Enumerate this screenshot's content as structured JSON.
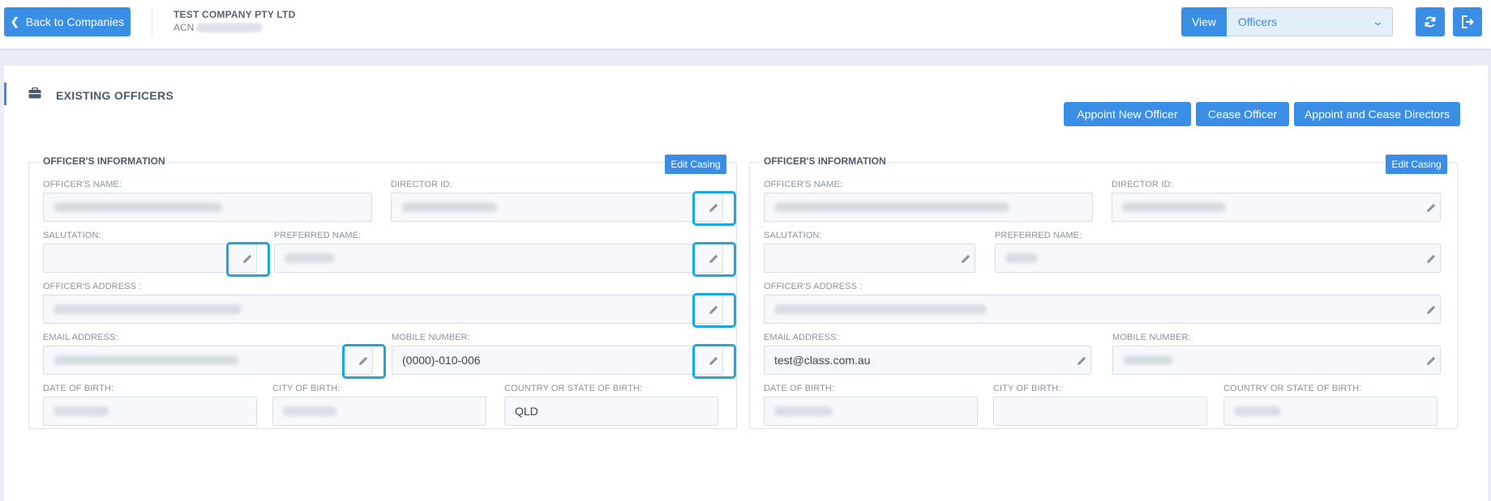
{
  "header": {
    "back_label": "Back to Companies",
    "company_name": "TEST COMPANY PTY LTD",
    "acn_label": "ACN",
    "view_label": "View",
    "view_selected": "Officers"
  },
  "section": {
    "title": "EXISTING OFFICERS",
    "buttons": {
      "appoint": "Appoint New Officer",
      "cease": "Cease Officer",
      "appoint_cease": "Appoint and Cease Directors"
    }
  },
  "officers": [
    {
      "legend": "OFFICER'S INFORMATION",
      "edit_casing": "Edit Casing",
      "labels": {
        "name": "OFFICER'S NAME:",
        "director_id": "DIRECTOR ID:",
        "salutation": "SALUTATION:",
        "preferred_name": "PREFERRED NAME:",
        "address": "OFFICER'S ADDRESS :",
        "email": "EMAIL ADDRESS:",
        "mobile": "MOBILE NUMBER:",
        "dob": "DATE OF BIRTH:",
        "city": "CITY OF BIRTH:",
        "country": "COUNTRY OR STATE OF BIRTH:"
      },
      "values": {
        "mobile": "(0000)-010-006",
        "country": "QLD"
      }
    },
    {
      "legend": "OFFICER'S INFORMATION",
      "edit_casing": "Edit Casing",
      "labels": {
        "name": "OFFICER'S NAME:",
        "director_id": "DIRECTOR ID:",
        "salutation": "SALUTATION:",
        "preferred_name": "PREFERRED NAME:",
        "address": "OFFICER'S ADDRESS :",
        "email": "EMAIL ADDRESS:",
        "mobile": "MOBILE NUMBER:",
        "dob": "DATE OF BIRTH:",
        "city": "CITY OF BIRTH:",
        "country": "COUNTRY OR STATE OF BIRTH:"
      },
      "values": {
        "email": "test@class.com.au"
      }
    }
  ],
  "icons": {
    "back": "chevron-left-icon",
    "view_dropdown": "chevron-down-icon",
    "refresh": "refresh-icon",
    "logout": "sign-out-icon",
    "section": "briefcase-icon",
    "field_edit": "pencil-icon"
  },
  "colors": {
    "primary": "#3a8ee6",
    "highlight": "#19a9e1",
    "select_bg": "#e3eefb"
  }
}
